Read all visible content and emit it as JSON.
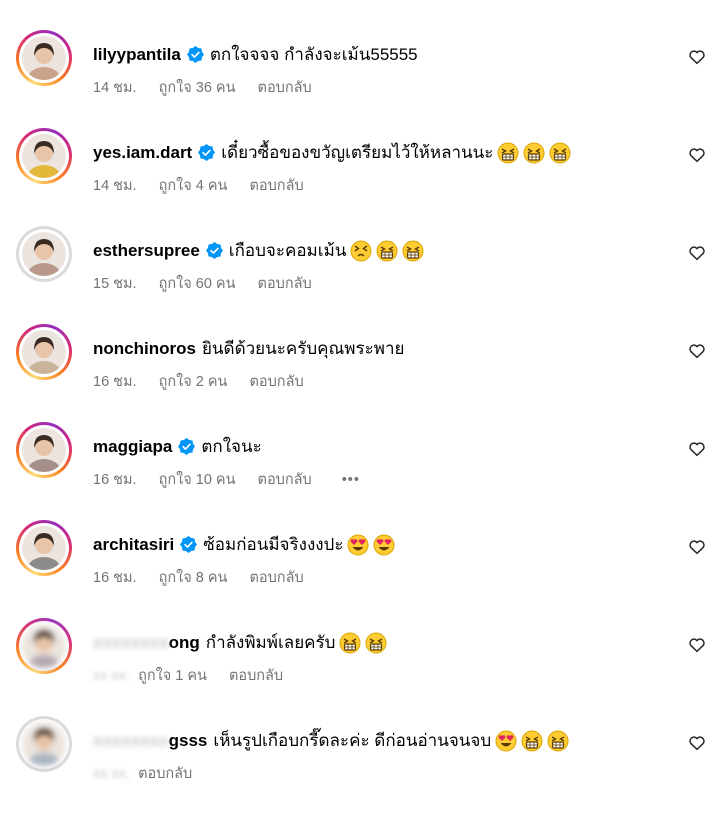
{
  "comments": [
    {
      "username": "lilyypantila",
      "verified": true,
      "text": "ตกใจจจจ กำลังจะเม้น55555",
      "emojis": [],
      "time": "14 ชม.",
      "likes": "ถูกใจ 36 คน",
      "reply": "ตอบกลับ",
      "avatar_color": "#c9a38a",
      "ring": "story"
    },
    {
      "username": "yes.iam.dart",
      "verified": true,
      "text": "เดี๋ยวซื้อของขวัญเตรียมไว้ให้หลานนะ",
      "emojis": [
        "grinning-squint",
        "grinning-squint",
        "grinning-squint"
      ],
      "time": "14 ชม.",
      "likes": "ถูกใจ 4 คน",
      "reply": "ตอบกลับ",
      "avatar_color": "#e3b93b",
      "ring": "story"
    },
    {
      "username": "esthersupree",
      "verified": true,
      "text": "เกือบจะคอมเม้น",
      "emojis": [
        "squint",
        "grinning-squint",
        "grinning-squint"
      ],
      "time": "15 ชม.",
      "likes": "ถูกใจ 60 คน",
      "reply": "ตอบกลับ",
      "avatar_color": "#b8988a",
      "ring": "plain"
    },
    {
      "username": "nonchinoros",
      "verified": false,
      "text": "ยินดีด้วยนะครับคุณพระพาย",
      "emojis": [],
      "time": "16 ชม.",
      "likes": "ถูกใจ 2 คน",
      "reply": "ตอบกลับ",
      "avatar_color": "#c9b49a",
      "ring": "story"
    },
    {
      "username": "maggiapa",
      "verified": true,
      "text": "ตกใจนะ",
      "emojis": [],
      "time": "16 ชม.",
      "likes": "ถูกใจ 10 คน",
      "reply": "ตอบกลับ",
      "more": "•••",
      "avatar_color": "#a58f8a",
      "ring": "story"
    },
    {
      "username": "architasiri",
      "verified": true,
      "text": "ซ้อมก่อนมีจริงงงปะ",
      "emojis": [
        "heart-eyes",
        "heart-eyes"
      ],
      "time": "16 ชม.",
      "likes": "ถูกใจ 8 คน",
      "reply": "ตอบกลับ",
      "avatar_color": "#8c8c8c",
      "ring": "story"
    },
    {
      "username": "ong",
      "verified": false,
      "text": "กำลังพิมพ์เลยครับ",
      "emojis": [
        "grinning-squint",
        "grinning-squint"
      ],
      "time": "",
      "likes": "ถูกใจ 1 คน",
      "reply": "ตอบกลับ",
      "avatar_color": "#b4a7b0",
      "ring": "story",
      "blurred": true
    },
    {
      "username": "gsss",
      "verified": false,
      "text": "เห็นรูปเกือบกรี๊ดละค่ะ ดีก่อนอ่านจนจบ",
      "emojis": [
        "heart-eyes",
        "grinning-squint",
        "grinning-squint"
      ],
      "time": "",
      "likes": "",
      "reply": "ตอบกลับ",
      "avatar_color": "#a9b4bf",
      "ring": "plain",
      "blurred": true
    }
  ],
  "icons": {
    "like": "heart-outline-icon",
    "verified": "verified-badge-icon"
  },
  "colors": {
    "verified": "#0095f6",
    "meta": "#737373",
    "text": "#000000"
  }
}
